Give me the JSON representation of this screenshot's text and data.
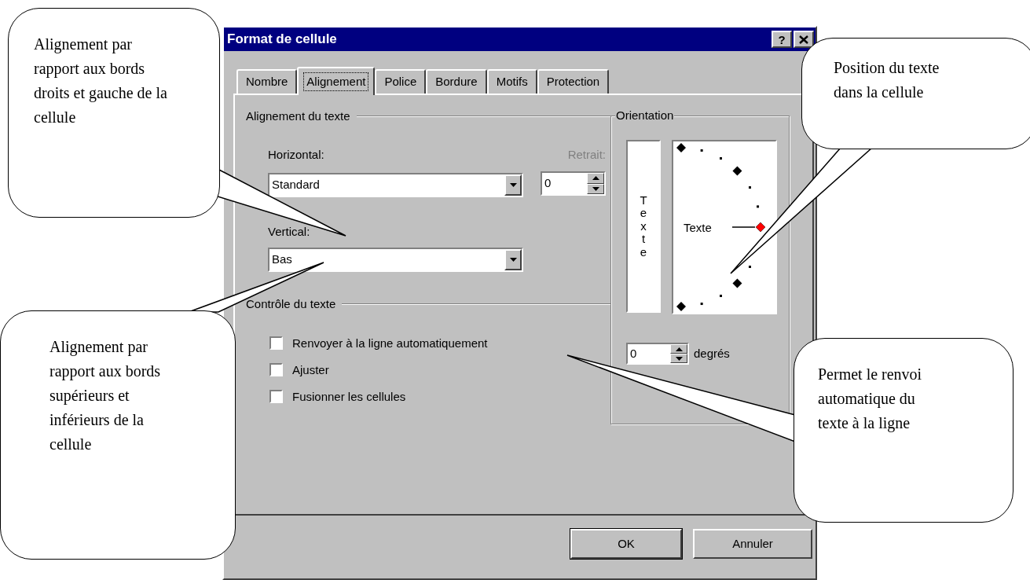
{
  "window": {
    "title": "Format de cellule",
    "help_button": "?"
  },
  "tabs": [
    {
      "label": "Nombre",
      "selected": false
    },
    {
      "label": "Alignement",
      "selected": true
    },
    {
      "label": "Police",
      "selected": false
    },
    {
      "label": "Bordure",
      "selected": false
    },
    {
      "label": "Motifs",
      "selected": false
    },
    {
      "label": "Protection",
      "selected": false
    }
  ],
  "text_alignment": {
    "label": "Alignement du texte",
    "horizontal": {
      "label": "Horizontal:",
      "value": "Standard"
    },
    "indent": {
      "label": "Retrait:",
      "value": "0",
      "disabled": true
    },
    "vertical": {
      "label": "Vertical:",
      "value": "Bas"
    }
  },
  "text_control": {
    "label": "Contrôle du texte",
    "options": [
      {
        "label": "Renvoyer à la ligne automatiquement",
        "checked": false
      },
      {
        "label": "Ajuster",
        "checked": false
      },
      {
        "label": "Fusionner les cellules",
        "checked": false
      }
    ]
  },
  "orientation": {
    "label": "Orientation",
    "vertical_text": "Texte",
    "dial_text": "Texte",
    "degrees": {
      "value": "0",
      "unit": "degrés"
    }
  },
  "buttons": [
    "OK",
    "Annuler"
  ],
  "callouts": [
    {
      "text": "Alignement par rapport aux bords droits et gauche de la cellule"
    },
    {
      "text": "Alignement par rapport aux bords supérieurs et inférieurs de la cellule"
    },
    {
      "text": "Position du texte dans la cellule"
    },
    {
      "text": "Permet le renvoi automatique du texte à la ligne"
    }
  ]
}
